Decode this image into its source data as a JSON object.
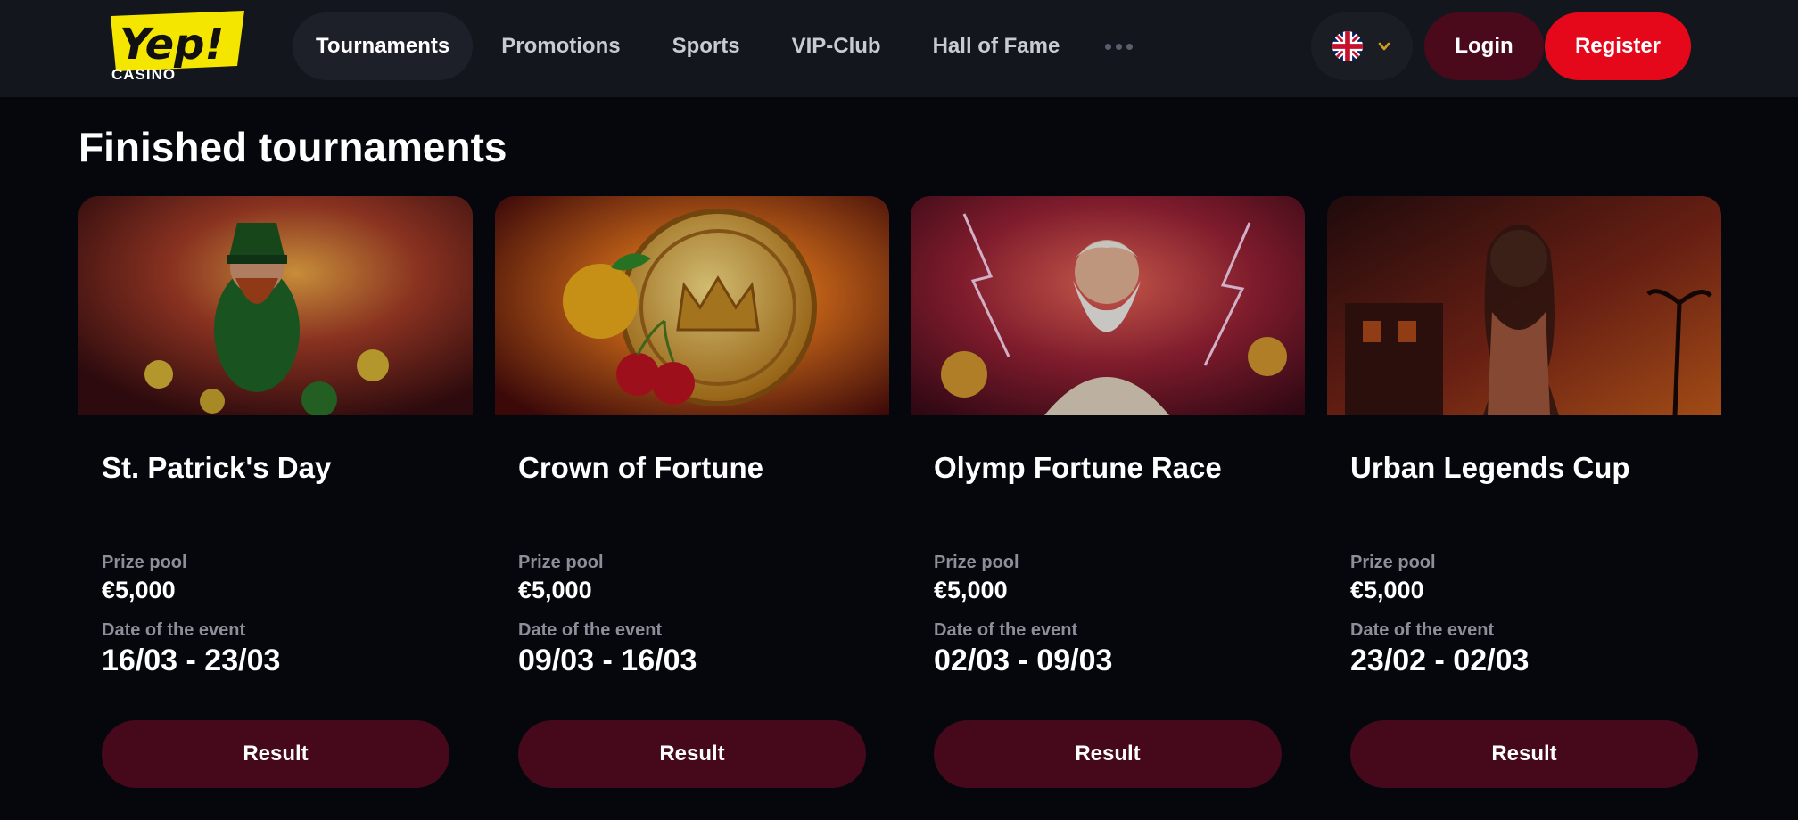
{
  "header": {
    "logo": {
      "wordmark": "Yep!",
      "subtitle": "CASINO"
    },
    "nav": [
      {
        "label": "Tournaments",
        "active": true
      },
      {
        "label": "Promotions"
      },
      {
        "label": "Sports"
      },
      {
        "label": "VIP-Club"
      },
      {
        "label": "Hall of Fame"
      }
    ],
    "more_icon": "ellipsis-icon",
    "language": {
      "flag": "uk-flag-icon",
      "chevron": "chevron-down-icon"
    },
    "login_label": "Login",
    "register_label": "Register"
  },
  "main": {
    "title": "Finished tournaments",
    "prize_label": "Prize pool",
    "date_label": "Date of the event",
    "cards": [
      {
        "title": "St. Patrick's Day",
        "prize": "€5,000",
        "dates": "16/03 - 23/03",
        "button": "Result"
      },
      {
        "title": "Crown of Fortune",
        "prize": "€5,000",
        "dates": "09/03 - 16/03",
        "button": "Result"
      },
      {
        "title": "Olymp Fortune Race",
        "prize": "€5,000",
        "dates": "02/03 - 09/03",
        "button": "Result"
      },
      {
        "title": "Urban Legends Cup",
        "prize": "€5,000",
        "dates": "23/02 - 02/03",
        "button": "Result"
      }
    ]
  },
  "colors": {
    "background": "#05070d",
    "header": "#14161e",
    "login": "#4a0a1c",
    "register": "#e5081b",
    "result_button": "#45091b",
    "logo_yellow": "#f5e600",
    "muted_text": "#8c8f99"
  }
}
